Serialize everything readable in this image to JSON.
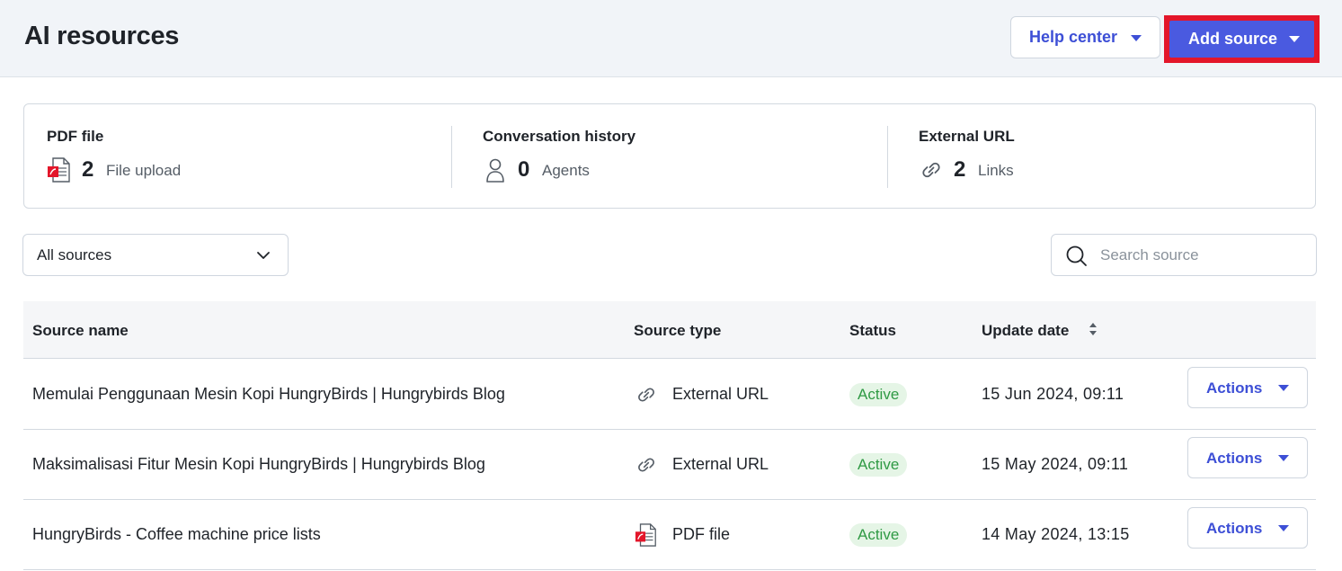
{
  "header": {
    "title": "AI resources",
    "help_center_label": "Help center",
    "add_source_label": "Add source"
  },
  "summary": [
    {
      "title": "PDF file",
      "count": "2",
      "unit": "File upload",
      "icon": "pdf-file-icon"
    },
    {
      "title": "Conversation history",
      "count": "0",
      "unit": "Agents",
      "icon": "person-icon"
    },
    {
      "title": "External URL",
      "count": "2",
      "unit": "Links",
      "icon": "link-icon"
    }
  ],
  "filter": {
    "selected": "All sources",
    "search_placeholder": "Search source"
  },
  "table": {
    "columns": [
      "Source name",
      "Source type",
      "Status",
      "Update date"
    ],
    "rows": [
      {
        "name": "Memulai Penggunaan Mesin Kopi HungryBirds | Hungrybirds Blog",
        "type": "External URL",
        "type_icon": "link-icon",
        "status": "Active",
        "date": "15 Jun 2024, 09:11",
        "action": "Actions"
      },
      {
        "name": "Maksimalisasi Fitur Mesin Kopi HungryBirds | Hungrybirds Blog",
        "type": "External URL",
        "type_icon": "link-icon",
        "status": "Active",
        "date": "15 May 2024, 09:11",
        "action": "Actions"
      },
      {
        "name": "HungryBirds - Coffee machine price lists",
        "type": "PDF file",
        "type_icon": "pdf-file-icon",
        "status": "Active",
        "date": "14 May 2024, 13:15",
        "action": "Actions"
      }
    ]
  },
  "colors": {
    "accent": "#4a5ae0",
    "link_text": "#3d4fd6",
    "highlight_border": "#e3162a",
    "status_active_bg": "#e5f5e6",
    "status_active_text": "#2f9a44"
  }
}
